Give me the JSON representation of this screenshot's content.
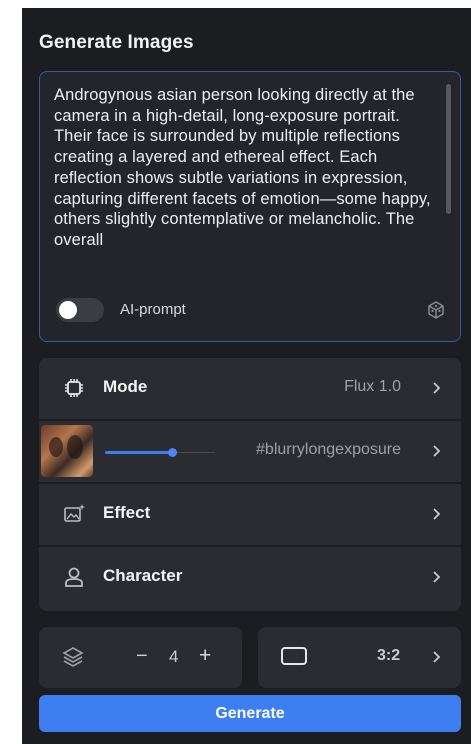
{
  "panel": {
    "title": "Generate Images"
  },
  "prompt": {
    "text": "Androgynous asian person looking directly at the camera in a high-detail, long-exposure portrait. Their face is surrounded by multiple reflections creating a layered and ethereal effect. Each reflection shows subtle variations in expression, capturing different facets of emotion—some happy, others slightly contemplative or melancholic. The overall",
    "ai_prompt_label": "AI-prompt",
    "ai_prompt_enabled": false
  },
  "menu": {
    "mode": {
      "label": "Mode",
      "value": "Flux 1.0",
      "icon": "chip-icon"
    },
    "style": {
      "value": "#blurrylongexposure",
      "strength": 0.62,
      "icon": "style-thumbnail"
    },
    "effect": {
      "label": "Effect",
      "icon": "image-sparkle-icon"
    },
    "character": {
      "label": "Character",
      "icon": "person-icon"
    }
  },
  "quantity": {
    "minus_label": "−",
    "value": "4",
    "plus_label": "+",
    "icon": "layers-icon"
  },
  "aspect_ratio": {
    "value": "3:2",
    "icon": "rectangle-icon"
  },
  "generate_button": {
    "label": "Generate"
  },
  "colors": {
    "panel_bg": "#1c1d21",
    "card_bg": "#2a2c31",
    "accent": "#3d7ef0",
    "prompt_border": "#3a5a9e"
  }
}
